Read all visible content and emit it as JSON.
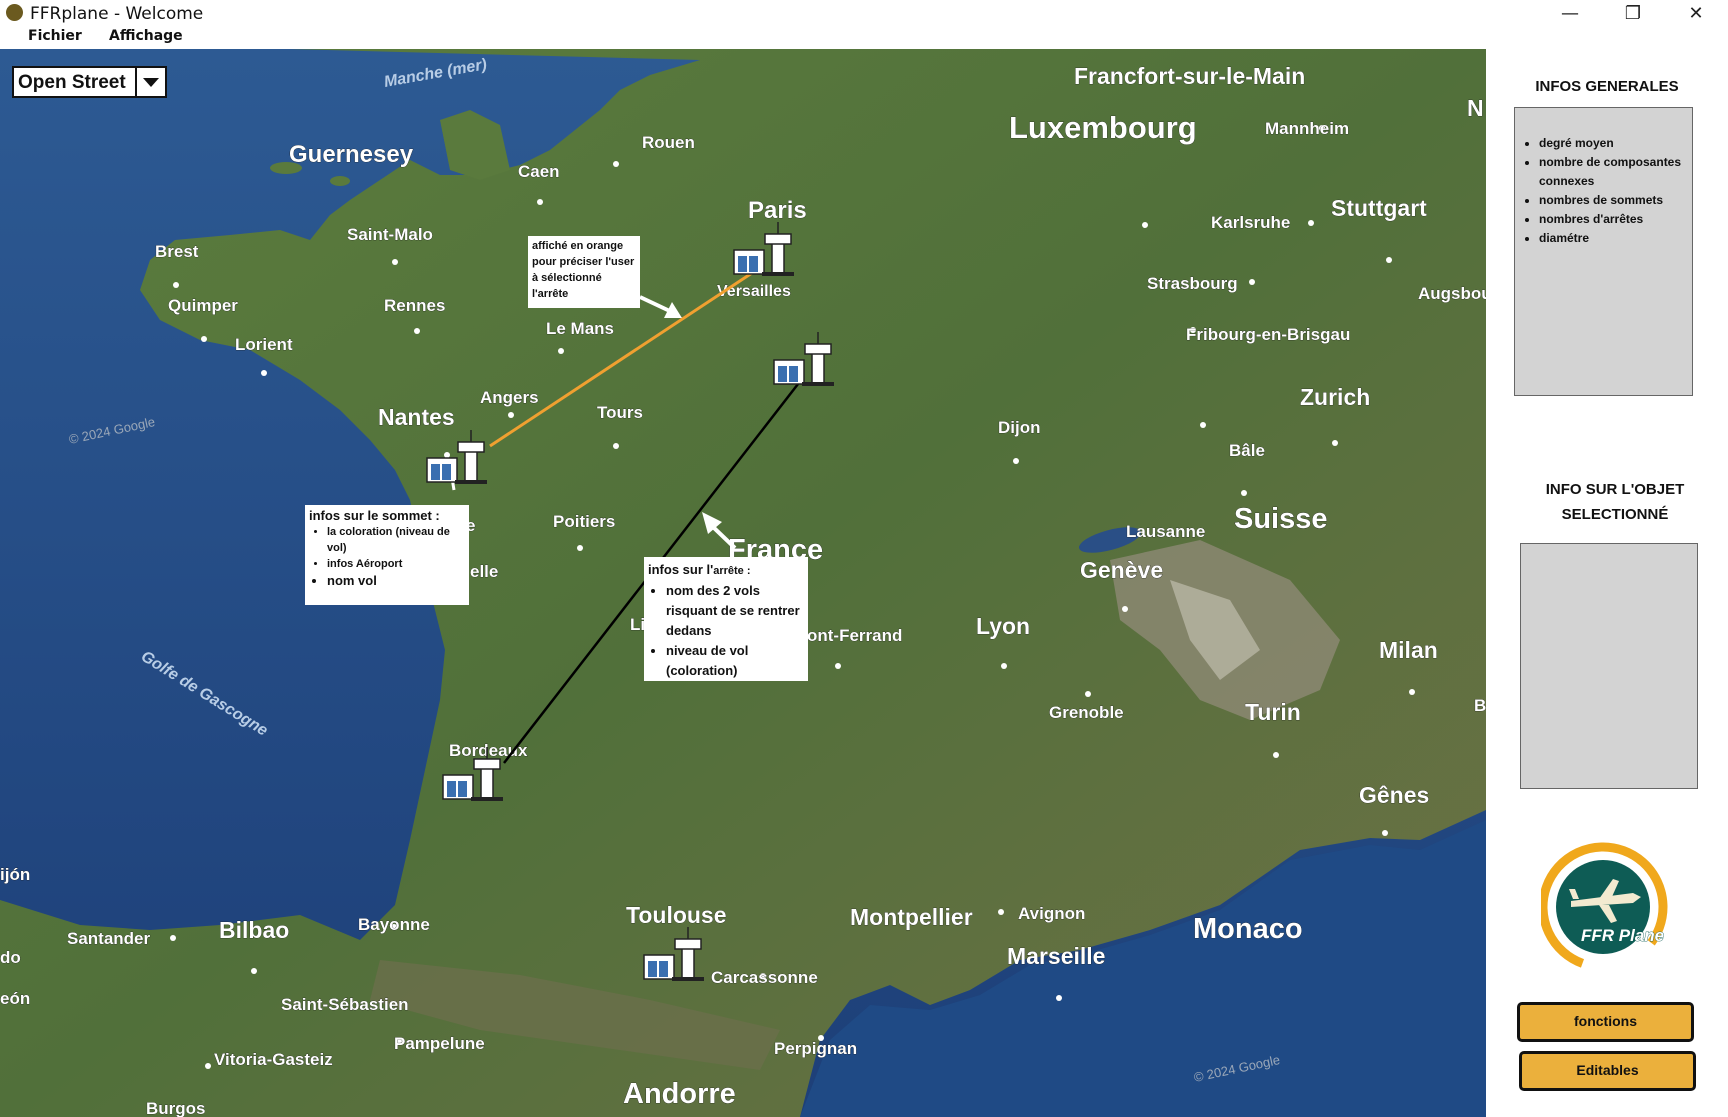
{
  "window": {
    "title": "FFRplane - Welcome",
    "controls": {
      "minimize": "—",
      "maximize": "❐",
      "close": "✕"
    }
  },
  "menu": {
    "items": [
      "Fichier",
      "Affichage"
    ]
  },
  "map": {
    "layer_select": {
      "value": "Open Street"
    },
    "labels": {
      "manche": "Manche (mer)",
      "guernesey": "Guernesey",
      "caen": "Caen",
      "rouen": "Rouen",
      "paris": "Paris",
      "versailles": "Versailles",
      "saint_malo": "Saint-Malo",
      "brest": "Brest",
      "quimper": "Quimper",
      "lorient": "Lorient",
      "rennes": "Rennes",
      "le_mans": "Le Mans",
      "angers": "Angers",
      "tours": "Tours",
      "nantes": "Nantes",
      "poitiers": "Poitiers",
      "france": "France",
      "golfe": "Golfe de Gascogne",
      "bordeaux": "Bordeaux",
      "bilbao": "Bilbao",
      "bayonne": "Bayonne",
      "santander": "Santander",
      "saint_sebastien": "Saint-Sébastien",
      "pampelune": "Pampelune",
      "vitoria": "Vitoria-Gasteiz",
      "burgos": "Burgos",
      "toulouse": "Toulouse",
      "carcassonne": "Carcassonne",
      "montpellier": "Montpellier",
      "perpignan": "Perpignan",
      "andorre": "Andorre",
      "marseille": "Marseille",
      "avignon": "Avignon",
      "monaco": "Monaco",
      "lyon": "Lyon",
      "grenoble": "Grenoble",
      "clermont": "ont-Ferrand",
      "dijon": "Dijon",
      "geneve": "Genève",
      "lausanne": "Lausanne",
      "suisse": "Suisse",
      "zurich": "Zurich",
      "bale": "Bâle",
      "fribourg": "Fribourg-en-Brisgau",
      "strasbourg": "Strasbourg",
      "karlsruhe": "Karlsruhe",
      "stuttgart": "Stuttgart",
      "augsbourg": "Augsbou",
      "mannheim": "Mannheim",
      "francfort": "Francfort-sur-le-Main",
      "luxembourg": "Luxembourg",
      "turin": "Turin",
      "milan": "Milan",
      "genes": "Gênes",
      "edge_ijon": "ijón",
      "edge_do": "do",
      "edge_eon": "eón",
      "edge_n": "N",
      "edge_b": "B",
      "edge_li": "Li",
      "edge_elle": "elle",
      "edge_e": "e",
      "watermark1": "© 2024 Google",
      "watermark2": "© 2024 Google"
    },
    "selected_edge_color": "#f0a030",
    "edge_color": "#000000",
    "annotations": {
      "orange_note": [
        "affiché en orange",
        "pour préciser l'user",
        "à sélectionné",
        "l'arrête"
      ],
      "vertex": {
        "title": "infos sur le sommet :",
        "items": [
          "la coloration (niveau de vol)",
          "infos Aéroport",
          "nom vol"
        ]
      },
      "edge": {
        "title_a": "infos sur l'",
        "title_b": "arrête :",
        "items": [
          "nom des 2 vols risquant de se rentrer dedans",
          "niveau de vol (coloration)"
        ]
      }
    }
  },
  "sidebar": {
    "general_title": "INFOS GENERALES",
    "general_items": [
      "degré moyen",
      "nombre de composantes connexes",
      "nombres de sommets",
      "nombres d'arrêtes",
      "diamétre"
    ],
    "selected_title_line1": "INFO SUR L'OBJET",
    "selected_title_line2": "SELECTIONNÉ",
    "logo_text": "FFR Plane",
    "buttons": {
      "fonctions": "fonctions",
      "editables": "Editables"
    }
  }
}
